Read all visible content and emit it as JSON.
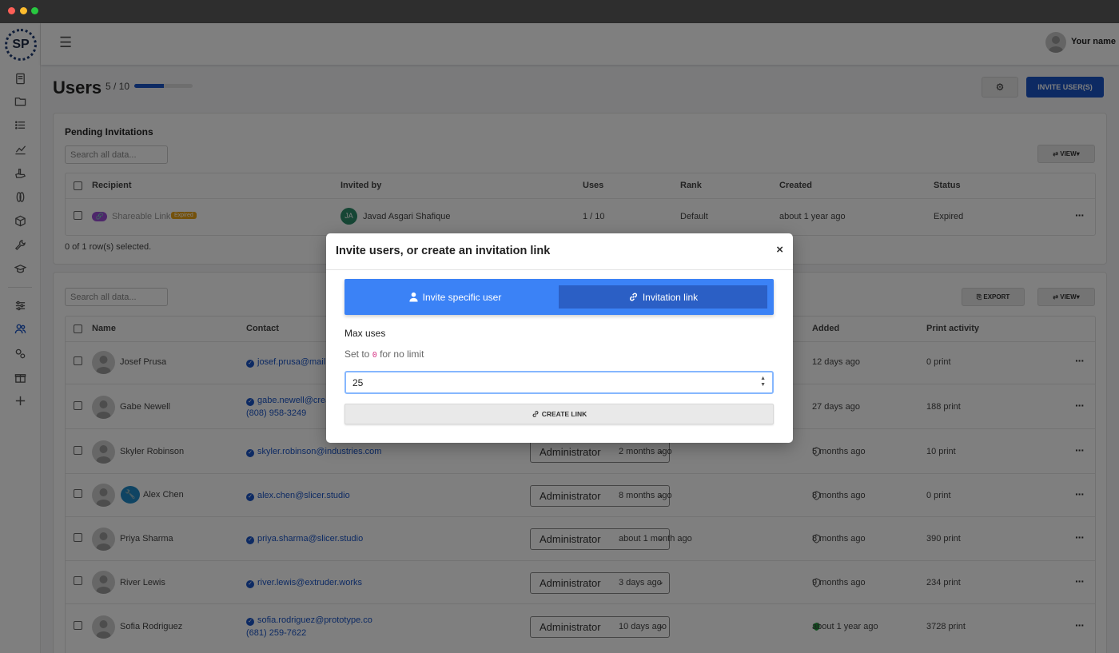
{
  "colors": {
    "accent": "#1a55c7",
    "tab_active": "#2b5fc5",
    "tabbar": "#3b82f6"
  },
  "app": {
    "logo": "SP",
    "user_name": "Your name",
    "sidebar_icons": [
      "book-icon",
      "folder-icon",
      "list-icon",
      "chart-icon",
      "hand-icon",
      "filament-icon",
      "box-icon",
      "wrench-icon",
      "graduation-cap-icon",
      "sliders-icon",
      "users-icon",
      "gears-icon",
      "gift-icon",
      "plus-icon"
    ]
  },
  "page": {
    "title": "Users",
    "seats": "5 / 10",
    "seats_fraction": 0.5,
    "invite_button": "INVITE USER(S)"
  },
  "pending": {
    "title": "Pending Invitations",
    "search_placeholder": "Search all data...",
    "view_label": "VIEW",
    "headers": {
      "recipient": "Recipient",
      "invited_by": "Invited by",
      "uses": "Uses",
      "rank": "Rank",
      "created": "Created",
      "status": "Status"
    },
    "row": {
      "recipient": "Shareable Link",
      "badge": "Expired",
      "inviter_initials": "JA",
      "inviter": "Javad Asgari Shafique",
      "uses": "1 / 10",
      "rank": "Default",
      "created": "about 1 year ago",
      "status": "Expired"
    },
    "selection": "0 of 1 row(s) selected."
  },
  "users": {
    "search_placeholder": "Search all data...",
    "export_label": "EXPORT",
    "view_label": "VIEW",
    "headers": {
      "name": "Name",
      "contact": "Contact",
      "added": "Added",
      "print_activity": "Print activity"
    },
    "rows": [
      {
        "name": "Josef Prusa",
        "email": "josef.prusa@mail.c",
        "phone": "",
        "role": "",
        "last_active": "",
        "added": "12 days ago",
        "prints": "0 print",
        "admin": false
      },
      {
        "name": "Gabe Newell",
        "email": "gabe.newell@crea",
        "phone": "(808) 958-3249",
        "role": "",
        "last_active": "",
        "added": "27 days ago",
        "prints": "188 print",
        "admin": false
      },
      {
        "name": "Skyler Robinson",
        "email": "skyler.robinson@industries.com",
        "phone": "",
        "role": "Administrator",
        "last_active": "2 months ago",
        "added": "5 months ago",
        "prints": "10 print",
        "admin": false
      },
      {
        "name": "Alex Chen",
        "email": "alex.chen@slicer.studio",
        "phone": "",
        "role": "Administrator",
        "last_active": "8 months ago",
        "added": "8 months ago",
        "prints": "0 print",
        "admin": false
      },
      {
        "name": "Priya Sharma",
        "email": "priya.sharma@slicer.studio",
        "phone": "",
        "role": "Administrator",
        "last_active": "about 1 month ago",
        "added": "8 months ago",
        "prints": "390 print",
        "admin": false
      },
      {
        "name": "River Lewis",
        "email": "river.lewis@extruder.works",
        "phone": "",
        "role": "Administrator",
        "last_active": "3 days ago",
        "added": "9 months ago",
        "prints": "234 print",
        "admin": false
      },
      {
        "name": "Sofia Rodriguez",
        "email": "sofia.rodriguez@prototype.co",
        "phone": "(681) 259-7622",
        "role": "Administrator",
        "last_active": "10 days ago",
        "added": "about 1 year ago",
        "prints": "3728 print",
        "admin": true
      }
    ]
  },
  "modal": {
    "title": "Invite users, or create an invitation link",
    "close": "×",
    "tab_user": "Invite specific user",
    "tab_link": "Invitation link",
    "max_uses_label": "Max uses",
    "hint_prefix": "Set to",
    "hint_code": "0",
    "hint_suffix": "for no limit",
    "max_uses_value": "25",
    "create_button": "CREATE LINK"
  }
}
